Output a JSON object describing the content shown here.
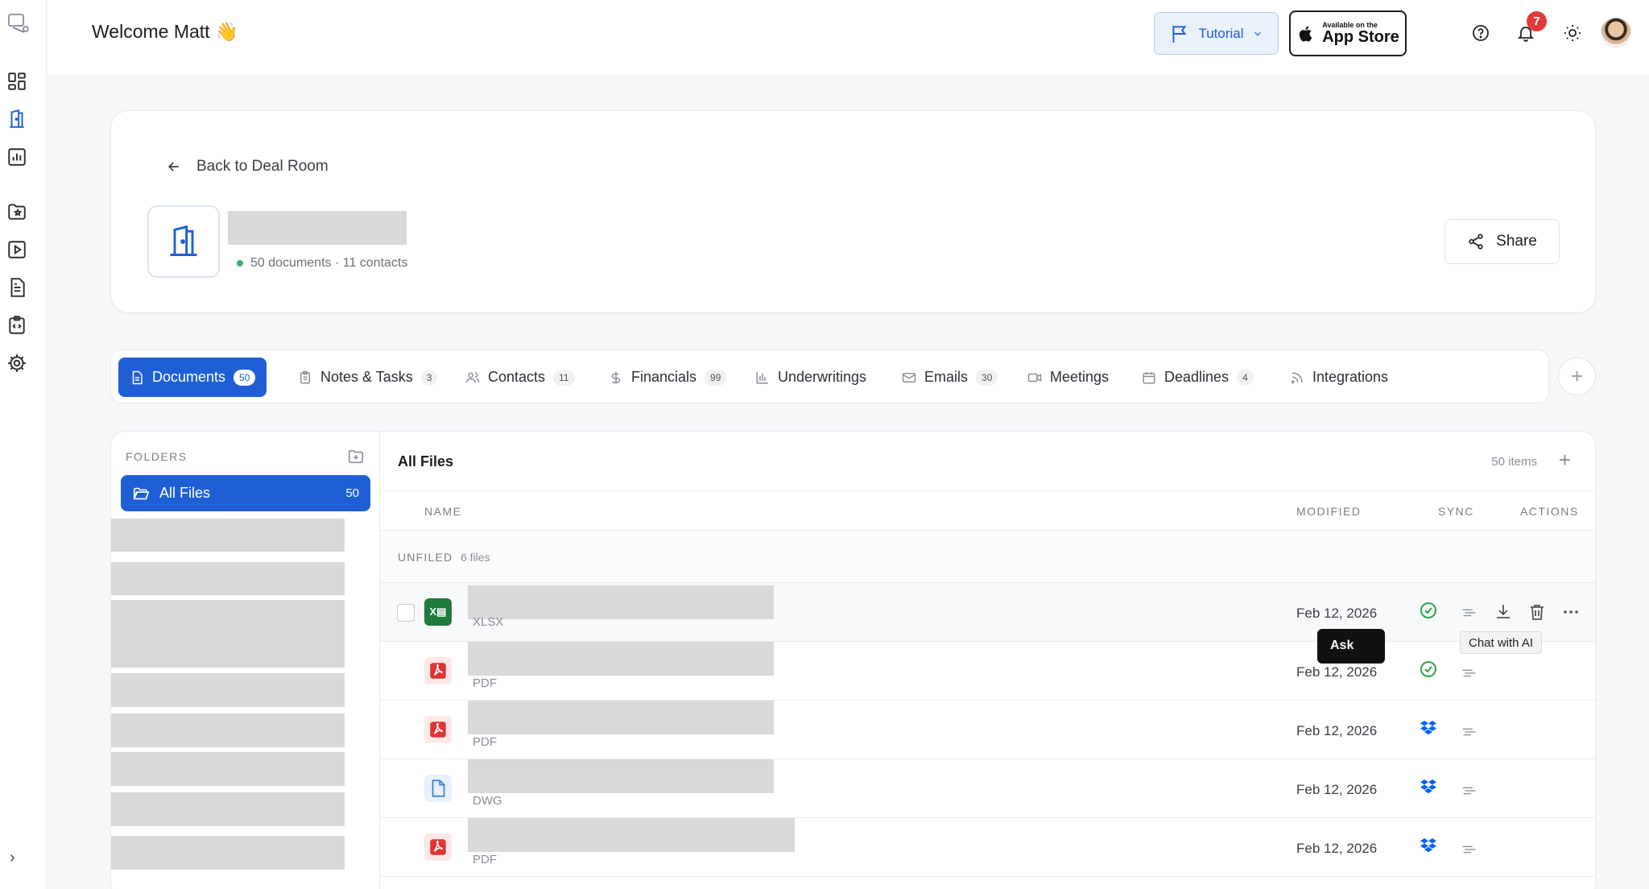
{
  "header": {
    "welcome": "Welcome Matt 👋",
    "tutorial_label": "Tutorial",
    "appstore_small": "Available on the",
    "appstore_big": "App Store",
    "notification_count": "7"
  },
  "deal": {
    "back_label": "Back to Deal Room",
    "meta": "50 documents · 11 contacts",
    "share_label": "Share"
  },
  "tabs": [
    {
      "label": "Documents",
      "count": "50",
      "icon": "document-icon"
    },
    {
      "label": "Notes & Tasks",
      "count": "3",
      "icon": "clipboard-icon"
    },
    {
      "label": "Contacts",
      "count": "11",
      "icon": "users-icon"
    },
    {
      "label": "Financials",
      "count": "99",
      "icon": "dollar-icon"
    },
    {
      "label": "Underwritings",
      "count": "",
      "icon": "bar-chart-icon"
    },
    {
      "label": "Emails",
      "count": "30",
      "icon": "mail-icon"
    },
    {
      "label": "Meetings",
      "count": "",
      "icon": "video-icon"
    },
    {
      "label": "Deadlines",
      "count": "4",
      "icon": "calendar-icon"
    },
    {
      "label": "Integrations",
      "count": "",
      "icon": "rss-icon"
    }
  ],
  "folders": {
    "label": "FOLDERS",
    "all_files_label": "All Files",
    "all_files_count": "50"
  },
  "files": {
    "title": "All Files",
    "items_count": "50 items",
    "columns": {
      "name": "NAME",
      "modified": "MODIFIED",
      "sync": "SYNC",
      "actions": "ACTIONS"
    },
    "group_label": "UNFILED",
    "group_count": "6 files",
    "rows": [
      {
        "type": "XLSX",
        "modified": "Feb 12, 2026",
        "sync": "synced"
      },
      {
        "type": "PDF",
        "modified": "Feb 12, 2026",
        "sync": "synced"
      },
      {
        "type": "PDF",
        "modified": "Feb 12, 2026",
        "sync": "dropbox"
      },
      {
        "type": "DWG",
        "modified": "Feb 12, 2026",
        "sync": "dropbox"
      },
      {
        "type": "PDF",
        "modified": "Feb 12, 2026",
        "sync": "dropbox"
      }
    ]
  },
  "tooltips": {
    "ask": "Ask",
    "chat": "Chat with AI"
  },
  "colors": {
    "accent": "#1f5fd6",
    "badge": "#e23b3b",
    "sync_green": "#2fa34d",
    "dropbox_blue": "#0061fe"
  }
}
